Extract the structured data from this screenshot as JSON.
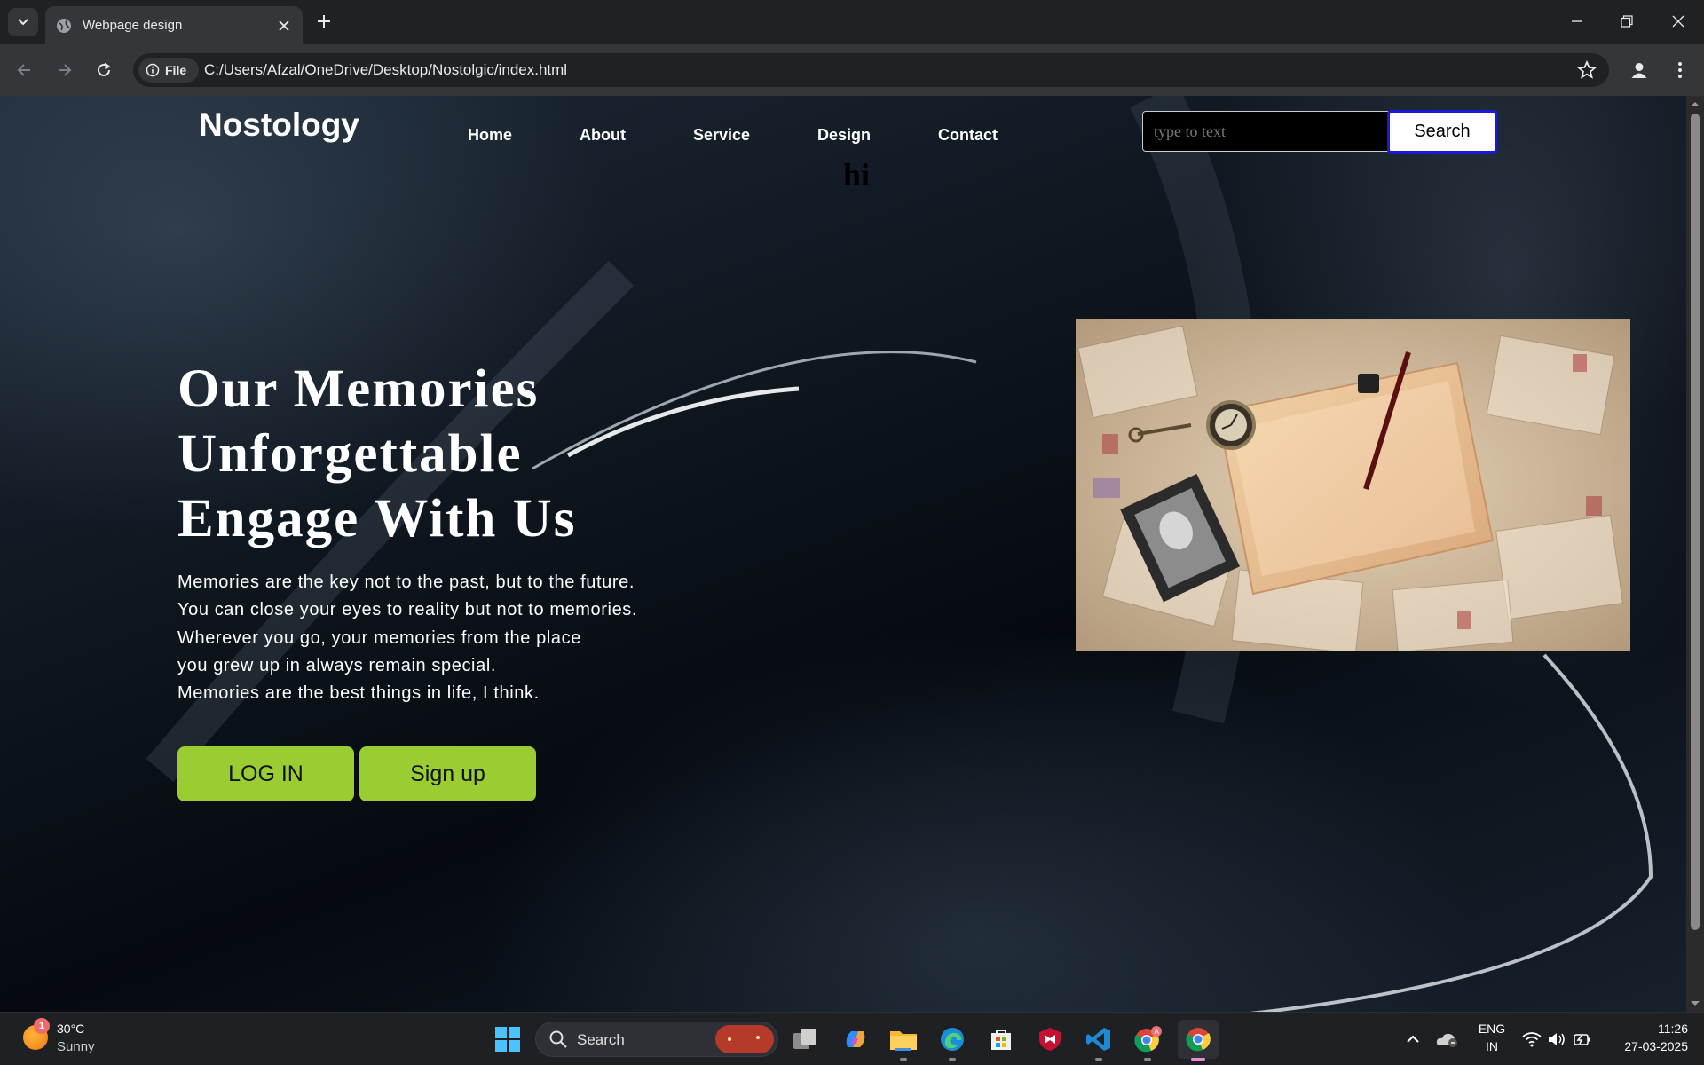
{
  "browser": {
    "tab_title": "Webpage design",
    "site_chip_label": "File",
    "url": "C:/Users/Afzal/OneDrive/Desktop/Nostolgic/index.html"
  },
  "page": {
    "brand": "Nostology",
    "nav": [
      "Home",
      "About",
      "Service",
      "Design",
      "Contact"
    ],
    "stray_text": "hi",
    "search": {
      "placeholder": "type to text",
      "button_label": "Search"
    },
    "hero": {
      "title_lines": [
        "Our Memories",
        "Unforgettable",
        "Engage With Us"
      ],
      "paragraph_lines": [
        "Memories are the key not to the past, but to the future.",
        "You can close your eyes to reality but not to memories.",
        "Wherever you go, your memories from the place",
        "you grew up in always remain special.",
        "Memories are the best things in life, I think."
      ],
      "login_label": "LOG IN",
      "signup_label": "Sign up"
    },
    "accent_color": "#9acd32"
  },
  "taskbar": {
    "weather_temp": "30°C",
    "weather_desc": "Sunny",
    "weather_badge": "1",
    "search_label": "Search",
    "language": "ENG",
    "region": "IN",
    "time": "11:26",
    "date": "27-03-2025"
  }
}
